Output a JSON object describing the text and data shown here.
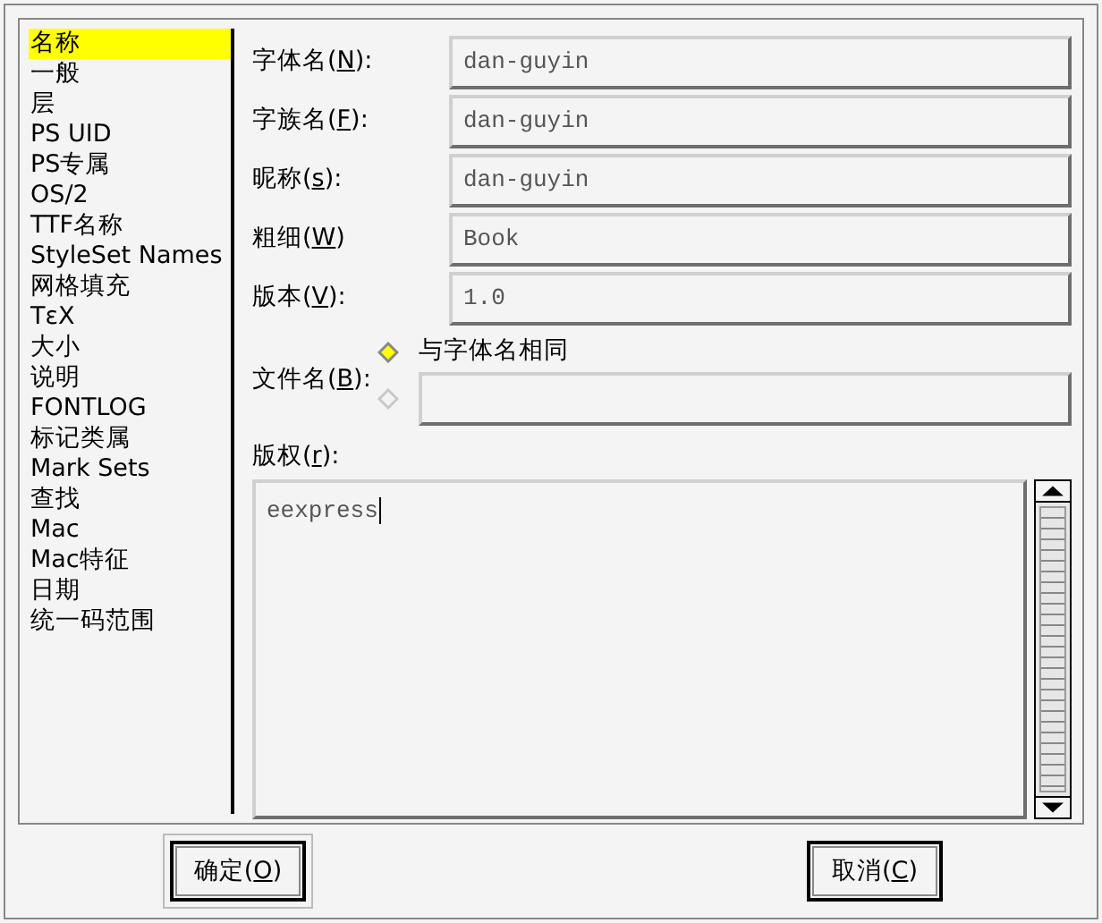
{
  "sidebar": {
    "items": [
      {
        "label": "名称",
        "selected": true
      },
      {
        "label": "一般",
        "selected": false
      },
      {
        "label": "层",
        "selected": false
      },
      {
        "label": "PS UID",
        "selected": false
      },
      {
        "label": "PS专属",
        "selected": false
      },
      {
        "label": "OS/2",
        "selected": false
      },
      {
        "label": "TTF名称",
        "selected": false
      },
      {
        "label": "StyleSet Names",
        "selected": false
      },
      {
        "label": "网格填充",
        "selected": false
      },
      {
        "label": "TεX",
        "selected": false
      },
      {
        "label": "大小",
        "selected": false
      },
      {
        "label": "说明",
        "selected": false
      },
      {
        "label": "FONTLOG",
        "selected": false
      },
      {
        "label": "标记类属",
        "selected": false
      },
      {
        "label": "Mark Sets",
        "selected": false
      },
      {
        "label": "查找",
        "selected": false
      },
      {
        "label": "Mac",
        "selected": false
      },
      {
        "label": "Mac特征",
        "selected": false
      },
      {
        "label": "日期",
        "selected": false
      },
      {
        "label": "统一码范围",
        "selected": false
      }
    ]
  },
  "fields": [
    {
      "label": {
        "before": "字体名(",
        "key": "N",
        "after": "):"
      },
      "value": "dan-guyin"
    },
    {
      "label": {
        "before": "字族名(",
        "key": "F",
        "after": "):"
      },
      "value": "dan-guyin"
    },
    {
      "label": {
        "before": "昵称(",
        "key": "s",
        "after": "):"
      },
      "value": "dan-guyin"
    },
    {
      "label": {
        "before": "粗细(",
        "key": "W",
        "after": ")"
      },
      "value": "Book"
    },
    {
      "label": {
        "before": "版本(",
        "key": "V",
        "after": "):"
      },
      "value": "1.0"
    }
  ],
  "filename": {
    "label": {
      "before": "文件名(",
      "key": "B",
      "after": "):"
    },
    "options": [
      {
        "label": "与字体名相同",
        "selected": true
      },
      {
        "selected": false
      }
    ]
  },
  "copyright": {
    "label": {
      "before": "版权(",
      "key": "r",
      "after": "):"
    },
    "value": "eexpress"
  },
  "buttons": [
    {
      "label": {
        "before": "确定(",
        "key": "O",
        "after": ")"
      },
      "default": true
    },
    {
      "label": {
        "before": "取消(",
        "key": "C",
        "after": ")"
      },
      "default": false
    }
  ]
}
